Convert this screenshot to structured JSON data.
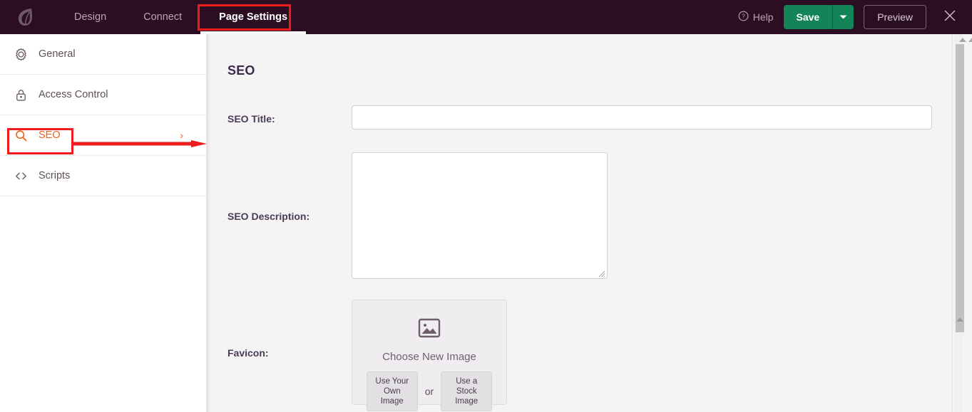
{
  "header": {
    "logo_icon": "leaf-logo-icon",
    "tabs": [
      {
        "label": "Design",
        "active": false
      },
      {
        "label": "Connect",
        "active": false
      },
      {
        "label": "Page Settings",
        "active": true
      }
    ],
    "help_label": "Help",
    "help_icon": "question-circle-icon",
    "save_label": "Save",
    "save_caret_icon": "chevron-down-icon",
    "preview_label": "Preview",
    "close_icon": "close-icon",
    "colors": {
      "background": "#2b0e22",
      "save_green": "#128457",
      "tab_inactive_text": "#b8a5b4",
      "tab_active_text": "#ffffff"
    }
  },
  "sidebar": {
    "items": [
      {
        "label": "General",
        "icon": "gear-icon",
        "active": false
      },
      {
        "label": "Access Control",
        "icon": "lock-icon",
        "active": false
      },
      {
        "label": "SEO",
        "icon": "search-icon",
        "active": true
      },
      {
        "label": "Scripts",
        "icon": "code-brackets-icon",
        "active": false
      }
    ],
    "chevron_icon": "chevron-right-icon",
    "active_color": "#ef6019"
  },
  "annotations": {
    "highlight_color": "#ee1c1c",
    "boxed_elements": [
      "Page Settings",
      "SEO"
    ],
    "arrow_from": "SEO",
    "arrow_to": "content-panel"
  },
  "content": {
    "panel_title": "SEO",
    "fields": {
      "seo_title": {
        "label": "SEO Title:",
        "value": "",
        "placeholder": ""
      },
      "seo_description": {
        "label": "SEO Description:",
        "value": "",
        "placeholder": ""
      },
      "favicon": {
        "label": "Favicon:",
        "image_icon": "image-placeholder-icon",
        "choose_label": "Choose New Image",
        "own_image_label": "Use Your Own Image",
        "or_label": "or",
        "stock_image_label": "Use a Stock Image"
      }
    }
  },
  "scrollbar": {
    "up_arrow_icon": "triangle-up-icon",
    "thumb_position": "top"
  }
}
